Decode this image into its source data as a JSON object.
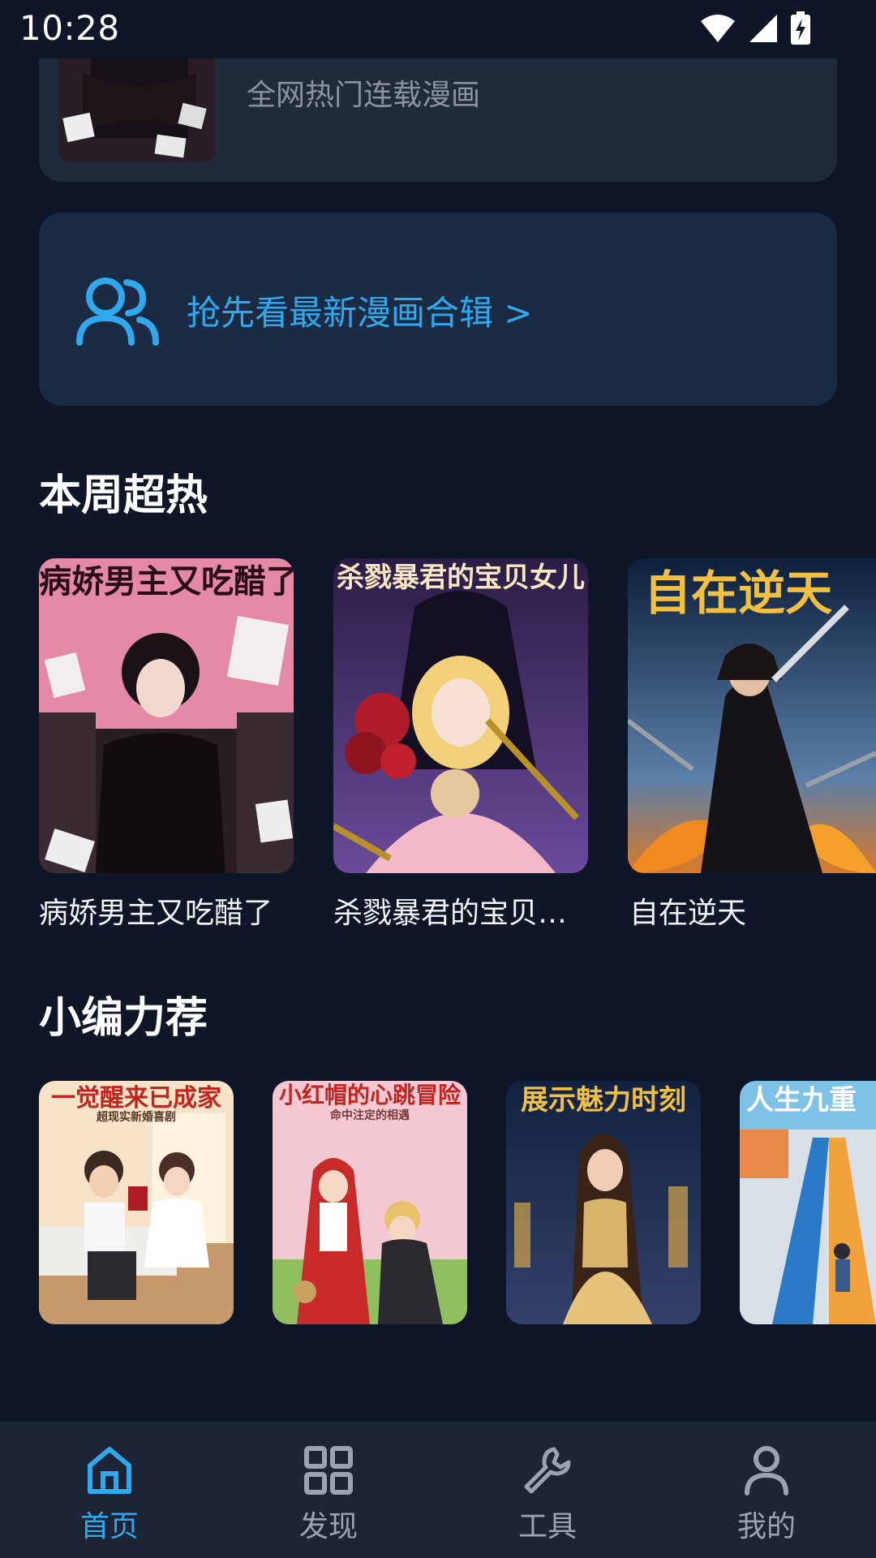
{
  "status_bar": {
    "time": "10:28",
    "icons": [
      "wifi-icon",
      "cell-signal-icon",
      "battery-charging-icon"
    ]
  },
  "top_card": {
    "subtitle": "全网热门连载漫画"
  },
  "promo": {
    "icon": "users-icon",
    "label": "抢先看最新漫画合辑 >"
  },
  "weekly_hot": {
    "title": "本周超热",
    "items": [
      {
        "caption": "病娇男主又吃醋了",
        "cover_text": "病娇男主又吃醋了"
      },
      {
        "caption": "杀戮暴君的宝贝…",
        "cover_text": "杀戮暴君的宝贝女儿"
      },
      {
        "caption": "自在逆天",
        "cover_text": "自在逆天"
      }
    ]
  },
  "editor_picks": {
    "title": "小编力荐",
    "items": [
      {
        "cover_text": "一觉醒来已成家",
        "cover_sub": "超现实新婚喜剧"
      },
      {
        "cover_text": "小红帽的心跳冒险",
        "cover_sub": "命中注定的相遇"
      },
      {
        "cover_text": "展示魅力时刻",
        "cover_sub": ""
      },
      {
        "cover_text": "人生九重",
        "cover_sub": ""
      }
    ]
  },
  "bottom_nav": {
    "items": [
      {
        "label": "首页",
        "icon": "home-icon",
        "active": true
      },
      {
        "label": "发现",
        "icon": "grid-icon",
        "active": false
      },
      {
        "label": "工具",
        "icon": "wrench-icon",
        "active": false
      },
      {
        "label": "我的",
        "icon": "user-icon",
        "active": false
      }
    ]
  },
  "colors": {
    "background": "#0e1628",
    "card": "#1f2a3d",
    "promo_bg": "#1c2b44",
    "accent": "#2ea9ee",
    "nav_bg": "#1c2536",
    "muted_text": "#8a93a3"
  }
}
